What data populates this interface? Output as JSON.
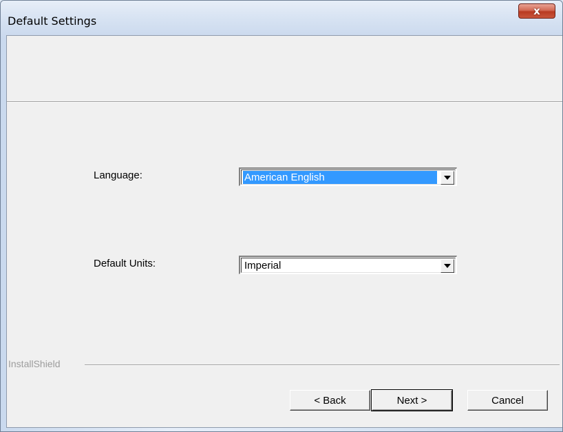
{
  "window": {
    "title": "Default Settings",
    "close_label": "x"
  },
  "form": {
    "language_label": "Language:",
    "language_value": "American English",
    "units_label": "Default Units:",
    "units_value": "Imperial"
  },
  "footer": {
    "brand": "InstallShield",
    "back_label": "< Back",
    "next_label": "Next >",
    "cancel_label": "Cancel"
  },
  "icons": {
    "close": "close-icon",
    "dropdown": "chevron-down-icon"
  },
  "colors": {
    "selection": "#3399ff",
    "close_button": "#c9563c",
    "dialog_background": "#f0f0f0"
  }
}
